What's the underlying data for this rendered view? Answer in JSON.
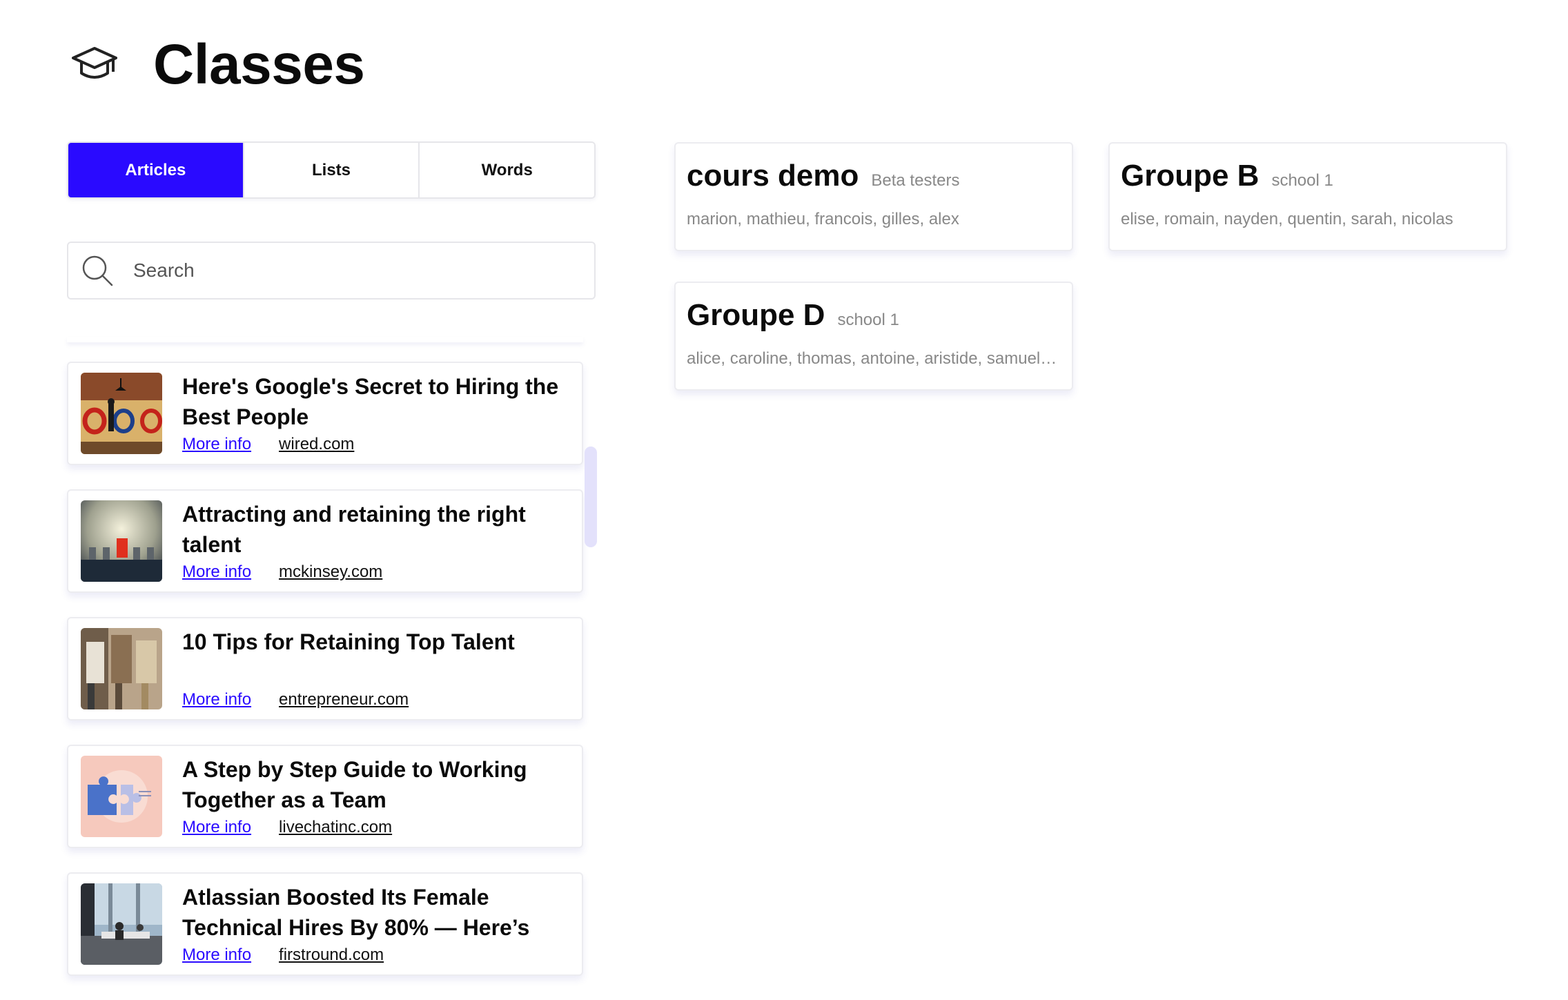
{
  "header": {
    "title": "Classes",
    "icon": "graduation-cap-icon"
  },
  "tabs": [
    {
      "label": "Articles",
      "active": true
    },
    {
      "label": "Lists",
      "active": false
    },
    {
      "label": "Words",
      "active": false
    }
  ],
  "search": {
    "placeholder": "Search",
    "icon": "search-icon"
  },
  "articles": [
    {
      "title": "Here's Google's Secret to Hiring the Best People",
      "more_label": "More info",
      "domain": "wired.com"
    },
    {
      "title": "Attracting and retaining the right talent",
      "more_label": "More info",
      "domain": "mckinsey.com"
    },
    {
      "title": "10 Tips for Retaining Top Talent",
      "more_label": "More info",
      "domain": "entrepreneur.com"
    },
    {
      "title": "A Step by Step Guide to Working Together as a Team",
      "more_label": "More info",
      "domain": "livechatinc.com"
    },
    {
      "title": "Atlassian Boosted Its Female Technical Hires By 80% — Here’s",
      "more_label": "More info",
      "domain": "firstround.com"
    }
  ],
  "classes": [
    {
      "name": "cours demo",
      "school": "Beta testers",
      "members": "marion, mathieu, francois, gilles, alex"
    },
    {
      "name": "Groupe B",
      "school": "school 1",
      "members": "elise, romain, nayden, quentin, sarah, nicolas"
    },
    {
      "name": "Groupe D",
      "school": "school 1",
      "members": "alice, caroline, thomas, antoine, aristide, samuel…"
    }
  ],
  "colors": {
    "accent": "#2a0aff",
    "muted_text": "#888888",
    "scrollbar": "#e3e1fb"
  }
}
